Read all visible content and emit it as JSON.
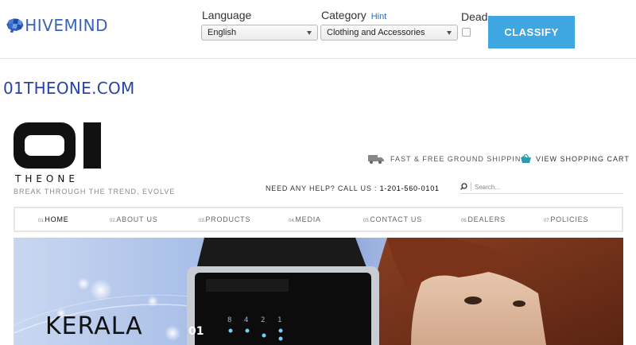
{
  "toolbar": {
    "logo_text": "HIVEMIND",
    "language_label": "Language",
    "language_value": "English",
    "category_label": "Category",
    "category_hint": "Hint",
    "category_value": "Clothing and Accessories",
    "dead_label": "Dead",
    "classify_label": "CLASSIFY"
  },
  "domain": "01THEONE.COM",
  "site": {
    "brand_sub": "THEONE",
    "tagline": "BREAK THROUGH THE TREND, EVOLVE",
    "shipping": "FAST & FREE GROUND SHIPPING",
    "cart": "VIEW SHOPPING CART",
    "help_prefix": "NEED ANY HELP? CALL US :",
    "help_phone": "1-201-560-0101",
    "search_placeholder": "Search...",
    "nav": [
      {
        "num": "01.",
        "label": "HOME"
      },
      {
        "num": "02.",
        "label": "ABOUT US"
      },
      {
        "num": "03.",
        "label": "PRODUCTS"
      },
      {
        "num": "04.",
        "label": "MEDIA"
      },
      {
        "num": "05.",
        "label": "CONTACT US"
      },
      {
        "num": "06.",
        "label": "DEALERS"
      },
      {
        "num": "07.",
        "label": "POLICIES"
      }
    ],
    "banner_title": "KERALA",
    "watch_logo": "01",
    "watch_digits": [
      "8",
      "4",
      "2",
      "1"
    ]
  },
  "colors": {
    "brand_blue": "#3a64b8",
    "classify_bg": "#3ea6e0",
    "domain_title": "#2843a8",
    "cart_icon": "#2a9bb0"
  }
}
